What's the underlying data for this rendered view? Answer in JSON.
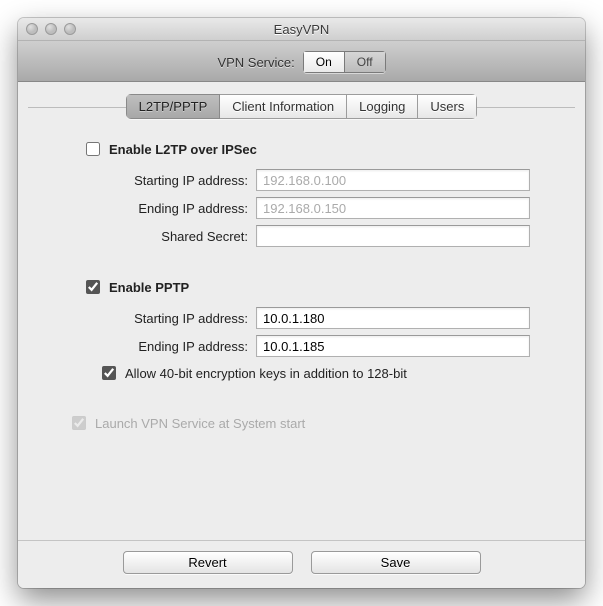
{
  "window": {
    "title": "EasyVPN"
  },
  "toolbar": {
    "service_label": "VPN Service:",
    "on": "On",
    "off": "Off",
    "state": "on"
  },
  "tabs": {
    "items": [
      {
        "label": "L2TP/PPTP",
        "active": true
      },
      {
        "label": "Client Information",
        "active": false
      },
      {
        "label": "Logging",
        "active": false
      },
      {
        "label": "Users",
        "active": false
      }
    ]
  },
  "l2tp": {
    "enable_label": "Enable L2TP over IPSec",
    "enabled": false,
    "start_label": "Starting IP address:",
    "start_value": "192.168.0.100",
    "end_label": "Ending IP address:",
    "end_value": "192.168.0.150",
    "secret_label": "Shared Secret:",
    "secret_value": ""
  },
  "pptp": {
    "enable_label": "Enable PPTP",
    "enabled": true,
    "start_label": "Starting IP address:",
    "start_value": "10.0.1.180",
    "end_label": "Ending IP address:",
    "end_value": "10.0.1.185",
    "allow40_label": "Allow 40-bit encryption keys in addition to 128-bit",
    "allow40": true
  },
  "launch": {
    "label": "Launch VPN Service at System start",
    "checked": true,
    "disabled": true
  },
  "footer": {
    "revert": "Revert",
    "save": "Save"
  }
}
